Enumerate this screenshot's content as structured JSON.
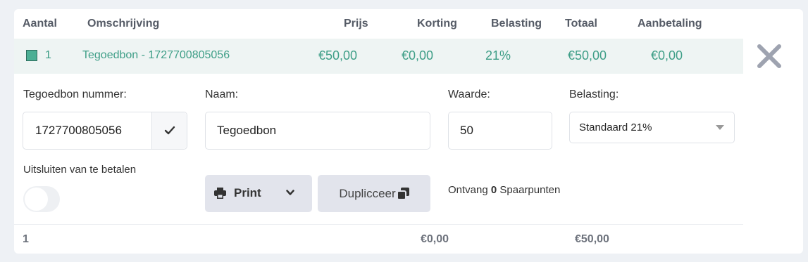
{
  "headers": {
    "aantal": "Aantal",
    "omschrijving": "Omschrijving",
    "prijs": "Prijs",
    "korting": "Korting",
    "belasting": "Belasting",
    "totaal": "Totaal",
    "aanbetaling": "Aanbetaling"
  },
  "row": {
    "aantal": "1",
    "omschrijving": "Tegoedbon - 1727700805056",
    "prijs": "€50,00",
    "korting": "€0,00",
    "belasting": "21%",
    "totaal": "€50,00",
    "aanbetaling": "€0,00"
  },
  "form": {
    "voucher_label": "Tegoedbon nummer:",
    "voucher_value": "1727700805056",
    "name_label": "Naam:",
    "name_value": "Tegoedbon",
    "value_label": "Waarde:",
    "value_value": "50",
    "tax_label": "Belasting:",
    "tax_selected": "Standaard 21%",
    "exclude_label": "Uitsluiten van te betalen",
    "print_label": "Print",
    "duplicate_label": "Duplicceer",
    "points_prefix": "Ontvang",
    "points_value": "0",
    "points_suffix": "Spaarpunten"
  },
  "footer": {
    "count": "1",
    "discount_total": "€0,00",
    "grand_total": "€50,00"
  },
  "colors": {
    "accent": "#3e9e87",
    "row_background": "#eef4f3",
    "button_background": "#e2e4ec",
    "close_icon": "#9ea3b0"
  },
  "icons": [
    "check-icon",
    "print-icon",
    "chevron-down-icon",
    "copy-icon",
    "close-icon",
    "caret-down-icon"
  ]
}
